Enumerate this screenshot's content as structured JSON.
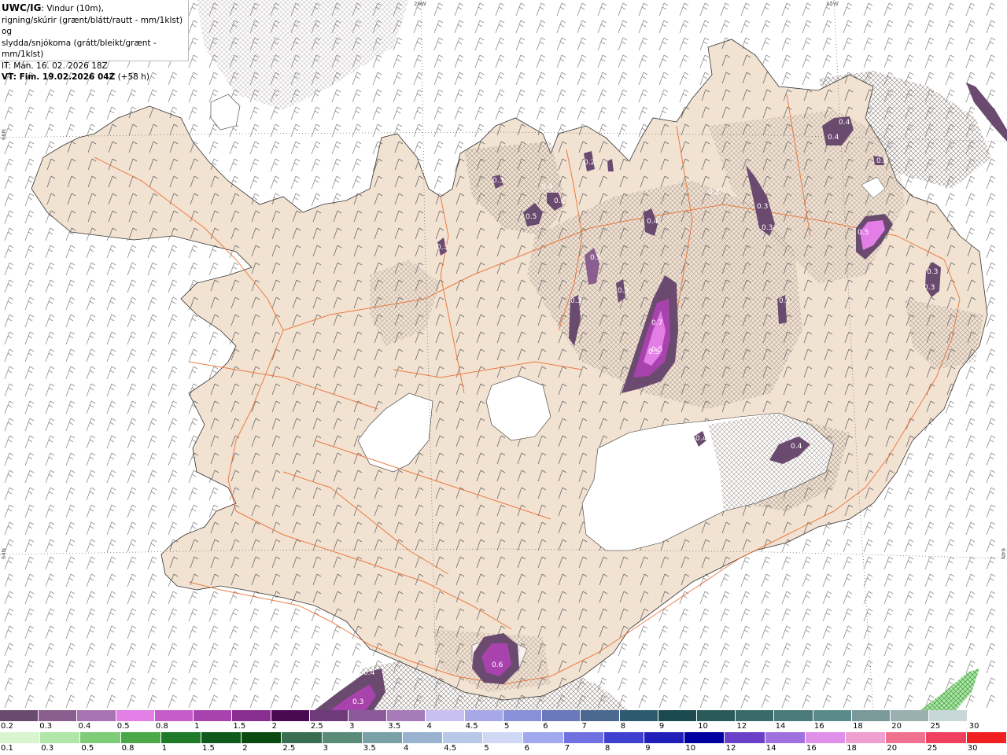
{
  "header": {
    "product": "UWC/IG",
    "line1_rest": ": Vindur (10m),",
    "line2": "rigning/skúrir (grænt/blátt/rautt - mm/1klst) og",
    "line3": "slydda/snjókoma (grátt/bleikt/grænt - mm/1klst)",
    "it": "IT: Mán. 16. 02. 2026 18Z",
    "vt_label": "VT: Fim. 19.02.2026 04Z",
    "vt_offset": " (+58 h)"
  },
  "grid_labels": {
    "lon1": "20W",
    "lon2": "15W",
    "lat1": "66N",
    "lat2": "64N",
    "lat3": "64N"
  },
  "precip_labels": [
    "0.3",
    "0.4",
    "0.3",
    "0.5",
    "0.5",
    "0.4",
    "0.5",
    "0.3",
    "0.3",
    "0.7",
    "0.5",
    "0.2",
    "0.3",
    "0.3",
    "0.2",
    "0.5",
    "0.4",
    "0.3",
    "0.3",
    "0.4",
    "0.4",
    "0.6",
    "0.4",
    "0.3",
    "0.3",
    "0.2",
    "0.4",
    "0.3"
  ],
  "legend_snow": {
    "labels": [
      "0.2",
      "0.3",
      "0.4",
      "0.5",
      "0.8",
      "1",
      "1.5",
      "2",
      "2.5",
      "3",
      "3.5",
      "4",
      "4.5",
      "5",
      "6",
      "7",
      "8",
      "9",
      "10",
      "12",
      "14",
      "16",
      "18",
      "20",
      "25",
      "30"
    ],
    "colors": [
      "#6b4a70",
      "#8a5e8e",
      "#a773b0",
      "#e27ee6",
      "#c65cc9",
      "#a843ad",
      "#8a2d90",
      "#4a0a52",
      "#6f3a7a",
      "#8a5a9a",
      "#a77ab8",
      "#c8c0f0",
      "#a8a8e8",
      "#8890d8",
      "#6878b8",
      "#4a6890",
      "#2e5a70",
      "#1a4a50",
      "#2a5a5a",
      "#3a6a6a",
      "#4a7a7a",
      "#5a8a8a",
      "#7a9a9a",
      "#9ab0b0",
      "#c8d8d8",
      "#ffffff"
    ]
  },
  "legend_rain": {
    "labels": [
      "0.1",
      "0.3",
      "0.5",
      "0.8",
      "1",
      "1.5",
      "2",
      "2.5",
      "3",
      "3.5",
      "4",
      "4.5",
      "5",
      "6",
      "7",
      "8",
      "9",
      "10",
      "12",
      "14",
      "16",
      "18",
      "20",
      "25",
      "30"
    ],
    "colors": [
      "#d8f5d0",
      "#b0e6a8",
      "#7ecb78",
      "#4aa848",
      "#1f7a2a",
      "#0d5a1a",
      "#0a4a10",
      "#3a6e52",
      "#5a8a78",
      "#7aa0a8",
      "#98b2d0",
      "#b8c8e8",
      "#d0d8f5",
      "#a0a8f0",
      "#7070e0",
      "#4040d0",
      "#2020b8",
      "#0000a0",
      "#6a40c8",
      "#a070e0",
      "#e090e8",
      "#f0a0d0",
      "#f07090",
      "#f04060",
      "#f02020"
    ]
  }
}
